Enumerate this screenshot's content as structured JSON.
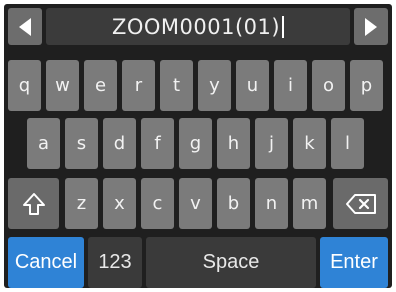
{
  "header": {
    "title": "ZOOM0001(01)",
    "prev_icon": "triangle-left-icon",
    "next_icon": "triangle-right-icon"
  },
  "keyboard": {
    "row1": [
      "q",
      "w",
      "e",
      "r",
      "t",
      "y",
      "u",
      "i",
      "o",
      "p"
    ],
    "row2": [
      "a",
      "s",
      "d",
      "f",
      "g",
      "h",
      "j",
      "k",
      "l"
    ],
    "row3": [
      "z",
      "x",
      "c",
      "v",
      "b",
      "n",
      "m"
    ],
    "shift_icon": "shift-arrow-icon",
    "backspace_icon": "backspace-icon"
  },
  "bottom": {
    "cancel": "Cancel",
    "num": "123",
    "space": "Space",
    "enter": "Enter"
  },
  "colors": {
    "screen_bg": "#1f1f1f",
    "key_bg": "#7b7b7b",
    "accent": "#2f83d6"
  }
}
